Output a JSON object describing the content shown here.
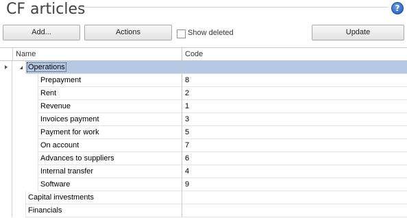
{
  "header": {
    "title": "CF articles",
    "help_label": "?"
  },
  "toolbar": {
    "add_label": "Add...",
    "actions_label": "Actions",
    "show_deleted_label": "Show deleted",
    "show_deleted_checked": false,
    "update_label": "Update"
  },
  "grid": {
    "columns": {
      "name": "Name",
      "code": "Code"
    },
    "rows": [
      {
        "name": "Operations",
        "code": "",
        "level": 0,
        "expanded": true,
        "selected": true
      },
      {
        "name": "Prepayment",
        "code": "8",
        "level": 1
      },
      {
        "name": "Rent",
        "code": "2",
        "level": 1
      },
      {
        "name": "Revenue",
        "code": "1",
        "level": 1
      },
      {
        "name": "Invoices payment",
        "code": "3",
        "level": 1
      },
      {
        "name": "Payment for work",
        "code": "5",
        "level": 1
      },
      {
        "name": "On account",
        "code": "7",
        "level": 1
      },
      {
        "name": "Advances to suppliers",
        "code": "6",
        "level": 1
      },
      {
        "name": "Internal transfer",
        "code": "4",
        "level": 1
      },
      {
        "name": "Software",
        "code": "9",
        "level": 1
      },
      {
        "name": "Capital investments",
        "code": "",
        "level": 0
      },
      {
        "name": "Financials",
        "code": "",
        "level": 0
      }
    ]
  },
  "colors": {
    "selection": "#b5c8e4",
    "grid_line": "#c8c8c8"
  },
  "icons": {
    "help": "help-icon",
    "row_indicator": "row-indicator-arrow-icon",
    "expander": "expander-icon"
  }
}
